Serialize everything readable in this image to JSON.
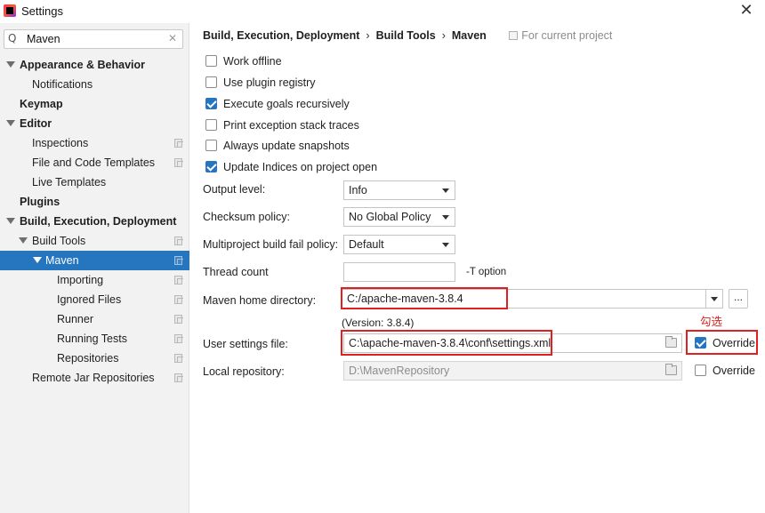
{
  "window": {
    "title": "Settings",
    "close_glyph": "✕",
    "app_icon": "intellij-idea-icon"
  },
  "search": {
    "value": "Maven",
    "icon_glyph": "Q",
    "clear_glyph": "✕"
  },
  "tree": [
    {
      "label": "Appearance & Behavior",
      "bold": true,
      "expanded": true,
      "level": 0,
      "config": false
    },
    {
      "label": "Notifications",
      "level": 1,
      "config": false
    },
    {
      "label": "Keymap",
      "bold": true,
      "level": 0,
      "config": false
    },
    {
      "label": "Editor",
      "bold": true,
      "expanded": true,
      "level": 0,
      "config": false
    },
    {
      "label": "Inspections",
      "level": 1,
      "config": true
    },
    {
      "label": "File and Code Templates",
      "level": 1,
      "config": true
    },
    {
      "label": "Live Templates",
      "level": 1,
      "config": false
    },
    {
      "label": "Plugins",
      "bold": true,
      "level": 0,
      "config": false
    },
    {
      "label": "Build, Execution, Deployment",
      "bold": true,
      "expanded": true,
      "level": 0,
      "config": false
    },
    {
      "label": "Build Tools",
      "expanded": true,
      "level": 1,
      "config": true
    },
    {
      "label": "Maven",
      "expanded": true,
      "level": 2,
      "config": true,
      "selected": true
    },
    {
      "label": "Importing",
      "level": 3,
      "config": true
    },
    {
      "label": "Ignored Files",
      "level": 3,
      "config": true
    },
    {
      "label": "Runner",
      "level": 3,
      "config": true
    },
    {
      "label": "Running Tests",
      "level": 3,
      "config": true
    },
    {
      "label": "Repositories",
      "level": 3,
      "config": true
    },
    {
      "label": "Remote Jar Repositories",
      "level": 1,
      "config": true
    }
  ],
  "breadcrumb": {
    "items": [
      "Build, Execution, Deployment",
      "Build Tools",
      "Maven"
    ],
    "separator": "›",
    "scope": "For current project"
  },
  "checkboxes": [
    {
      "label": "Work offline",
      "checked": false
    },
    {
      "label": "Use plugin registry",
      "checked": false
    },
    {
      "label": "Execute goals recursively",
      "checked": true
    },
    {
      "label": "Print exception stack traces",
      "checked": false
    },
    {
      "label": "Always update snapshots",
      "checked": false
    },
    {
      "label": "Update Indices on project open",
      "checked": true
    }
  ],
  "fields": {
    "output_level": {
      "label": "Output level:",
      "value": "Info"
    },
    "checksum_policy": {
      "label": "Checksum policy:",
      "value": "No Global Policy"
    },
    "fail_policy": {
      "label": "Multiproject build fail policy:",
      "value": "Default"
    },
    "thread_count": {
      "label": "Thread count",
      "value": "",
      "suffix": "-T option"
    },
    "maven_home": {
      "label": "Maven home directory:",
      "value": "C:/apache-maven-3.8.4",
      "version": "(Version: 3.8.4)",
      "browse_label": "..."
    },
    "user_settings": {
      "label": "User settings file:",
      "value": "C:\\apache-maven-3.8.4\\conf\\settings.xml",
      "override_label": "Override",
      "override_checked": true
    },
    "local_repo": {
      "label": "Local repository:",
      "value": "D:\\MavenRepository",
      "override_label": "Override",
      "override_checked": false
    }
  },
  "annotation": {
    "text": "勾选",
    "color": "#e02020"
  },
  "colors": {
    "accent": "#2675bf",
    "annotation_red": "#e02020",
    "sidebar_bg": "#f2f2f2"
  }
}
